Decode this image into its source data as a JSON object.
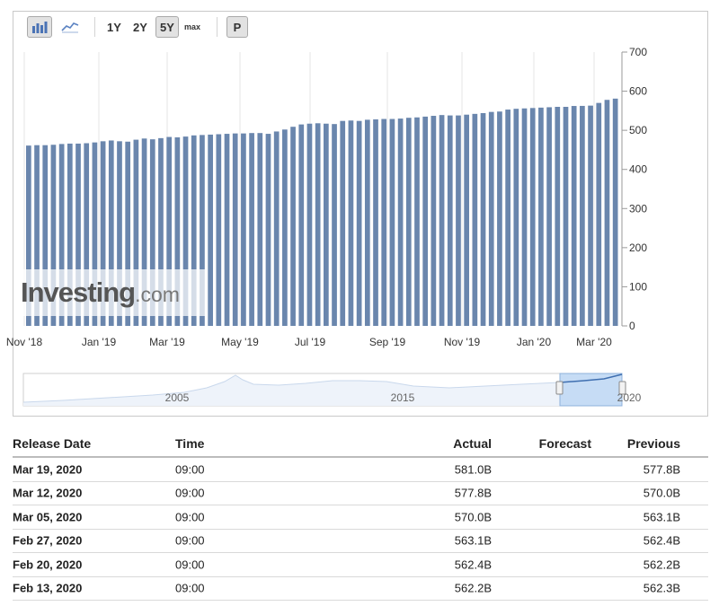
{
  "toolbar": {
    "bar_chart_label": "bar-chart",
    "line_chart_label": "line-chart",
    "ranges": [
      "1Y",
      "2Y",
      "5Y",
      "max"
    ],
    "active_range": "5Y",
    "p_button": "P"
  },
  "watermark": {
    "brand": "Investing",
    "suffix": ".com"
  },
  "chart_data": {
    "type": "bar",
    "color": "#6a86ad",
    "ylim": [
      0,
      700
    ],
    "yticks": [
      0,
      100,
      200,
      300,
      400,
      500,
      600,
      700
    ],
    "xtick_labels": [
      "Nov '18",
      "Jan '19",
      "Mar '19",
      "May '19",
      "Jul '19",
      "Sep '19",
      "Nov '19",
      "Jan '20",
      "Mar '20"
    ],
    "values": [
      461,
      462,
      462,
      463,
      465,
      466,
      466,
      467,
      469,
      472,
      474,
      472,
      471,
      476,
      479,
      477,
      480,
      483,
      482,
      484,
      487,
      488,
      489,
      490,
      491,
      492,
      492,
      493,
      493,
      491,
      497,
      502,
      509,
      515,
      517,
      518,
      517,
      516,
      524,
      525,
      524,
      527,
      528,
      529,
      529,
      530,
      532,
      533,
      535,
      537,
      539,
      538,
      538,
      540,
      542,
      544,
      547,
      548,
      553,
      555,
      556,
      557,
      558,
      559,
      560,
      560,
      562.2,
      562.4,
      563.1,
      570.0,
      577.8,
      581.0
    ]
  },
  "navigator": {
    "labels": [
      "2005",
      "2015",
      "2020"
    ]
  },
  "table": {
    "headers": {
      "date": "Release Date",
      "time": "Time",
      "actual": "Actual",
      "forecast": "Forecast",
      "previous": "Previous"
    },
    "rows": [
      {
        "date": "Mar 19, 2020",
        "time": "09:00",
        "actual": "581.0B",
        "forecast": "",
        "previous": "577.8B"
      },
      {
        "date": "Mar 12, 2020",
        "time": "09:00",
        "actual": "577.8B",
        "forecast": "",
        "previous": "570.0B"
      },
      {
        "date": "Mar 05, 2020",
        "time": "09:00",
        "actual": "570.0B",
        "forecast": "",
        "previous": "563.1B"
      },
      {
        "date": "Feb 27, 2020",
        "time": "09:00",
        "actual": "563.1B",
        "forecast": "",
        "previous": "562.4B"
      },
      {
        "date": "Feb 20, 2020",
        "time": "09:00",
        "actual": "562.4B",
        "forecast": "",
        "previous": "562.2B"
      },
      {
        "date": "Feb 13, 2020",
        "time": "09:00",
        "actual": "562.2B",
        "forecast": "",
        "previous": "562.3B"
      }
    ]
  }
}
